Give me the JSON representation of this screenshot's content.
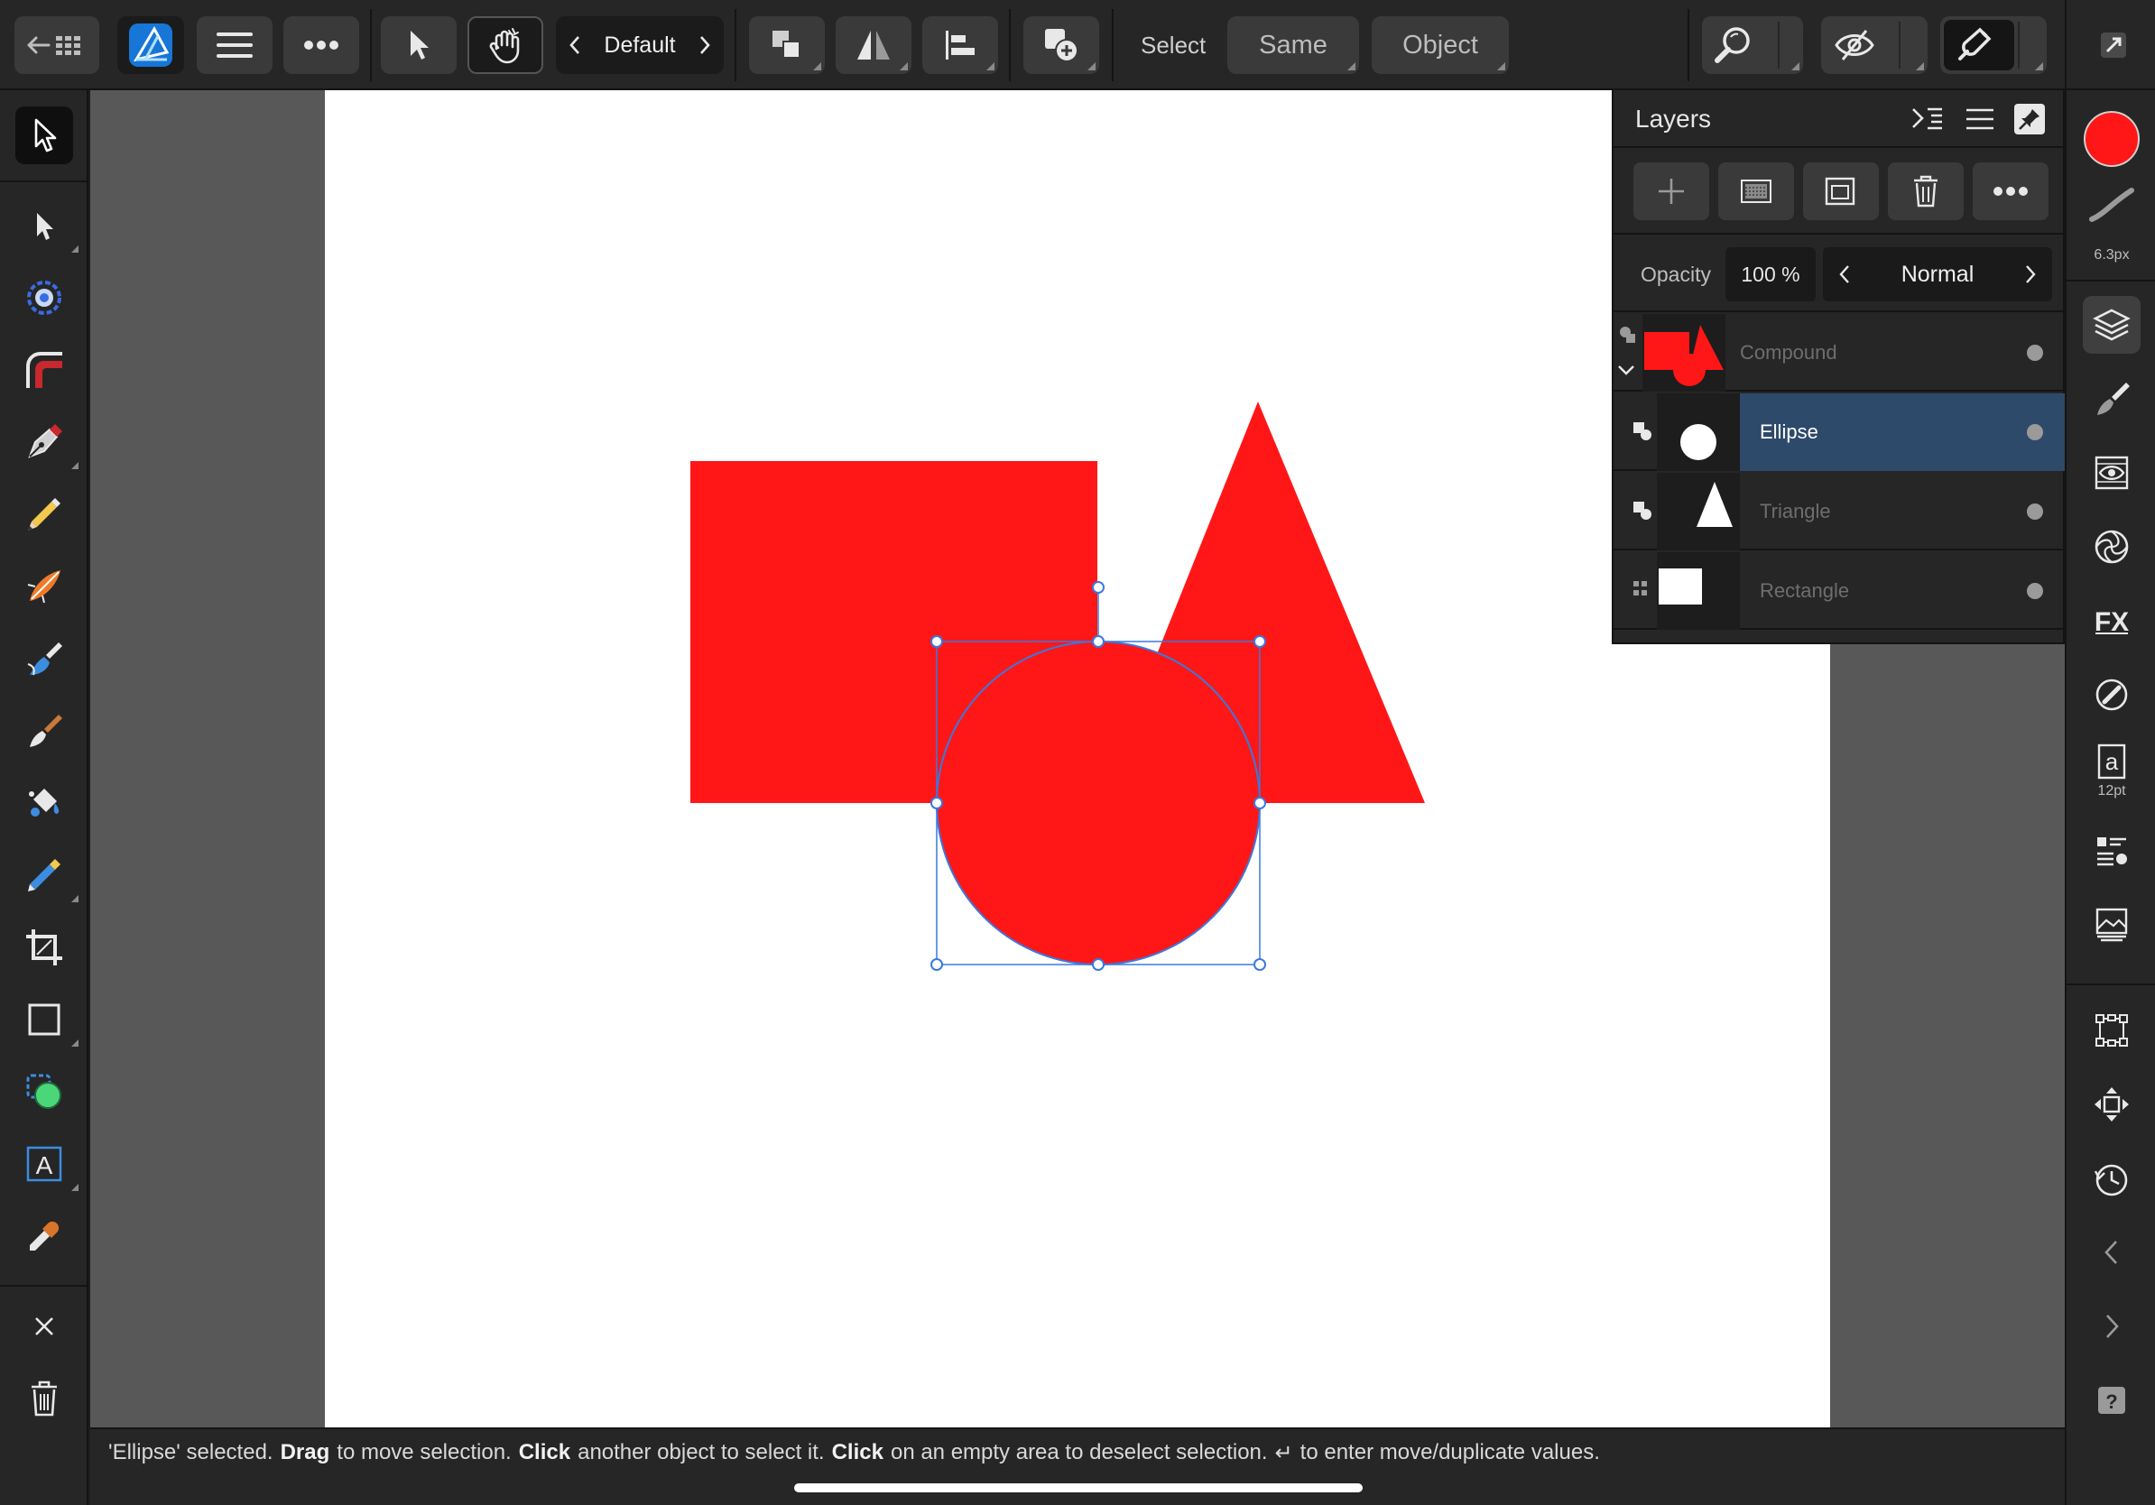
{
  "toolbar": {
    "persona_label": "Default",
    "select_label": "Select",
    "same_label": "Same",
    "object_label": "Object"
  },
  "status": {
    "part1": "'Ellipse' selected.",
    "b1": "Drag",
    "part2": "to move selection.",
    "b2": "Click",
    "part3": "another object to select it.",
    "b3": "Click",
    "part4": "on an empty area to deselect selection.",
    "enter_glyph": "↵",
    "part5": "to enter move/duplicate values."
  },
  "layers_panel": {
    "title": "Layers",
    "opacity_label": "Opacity",
    "opacity_value": "100 %",
    "blend_mode": "Normal",
    "layers": [
      {
        "name": "Compound",
        "selected": false
      },
      {
        "name": "Ellipse",
        "selected": true
      },
      {
        "name": "Triangle",
        "selected": false
      },
      {
        "name": "Rectangle",
        "selected": false
      }
    ]
  },
  "right_panel": {
    "stroke_width": "6.3px",
    "font_size": "12pt",
    "fill_color": "#ff1717"
  },
  "canvas": {
    "shape_color": "#ff1717",
    "selection_color": "#3a78e0"
  }
}
